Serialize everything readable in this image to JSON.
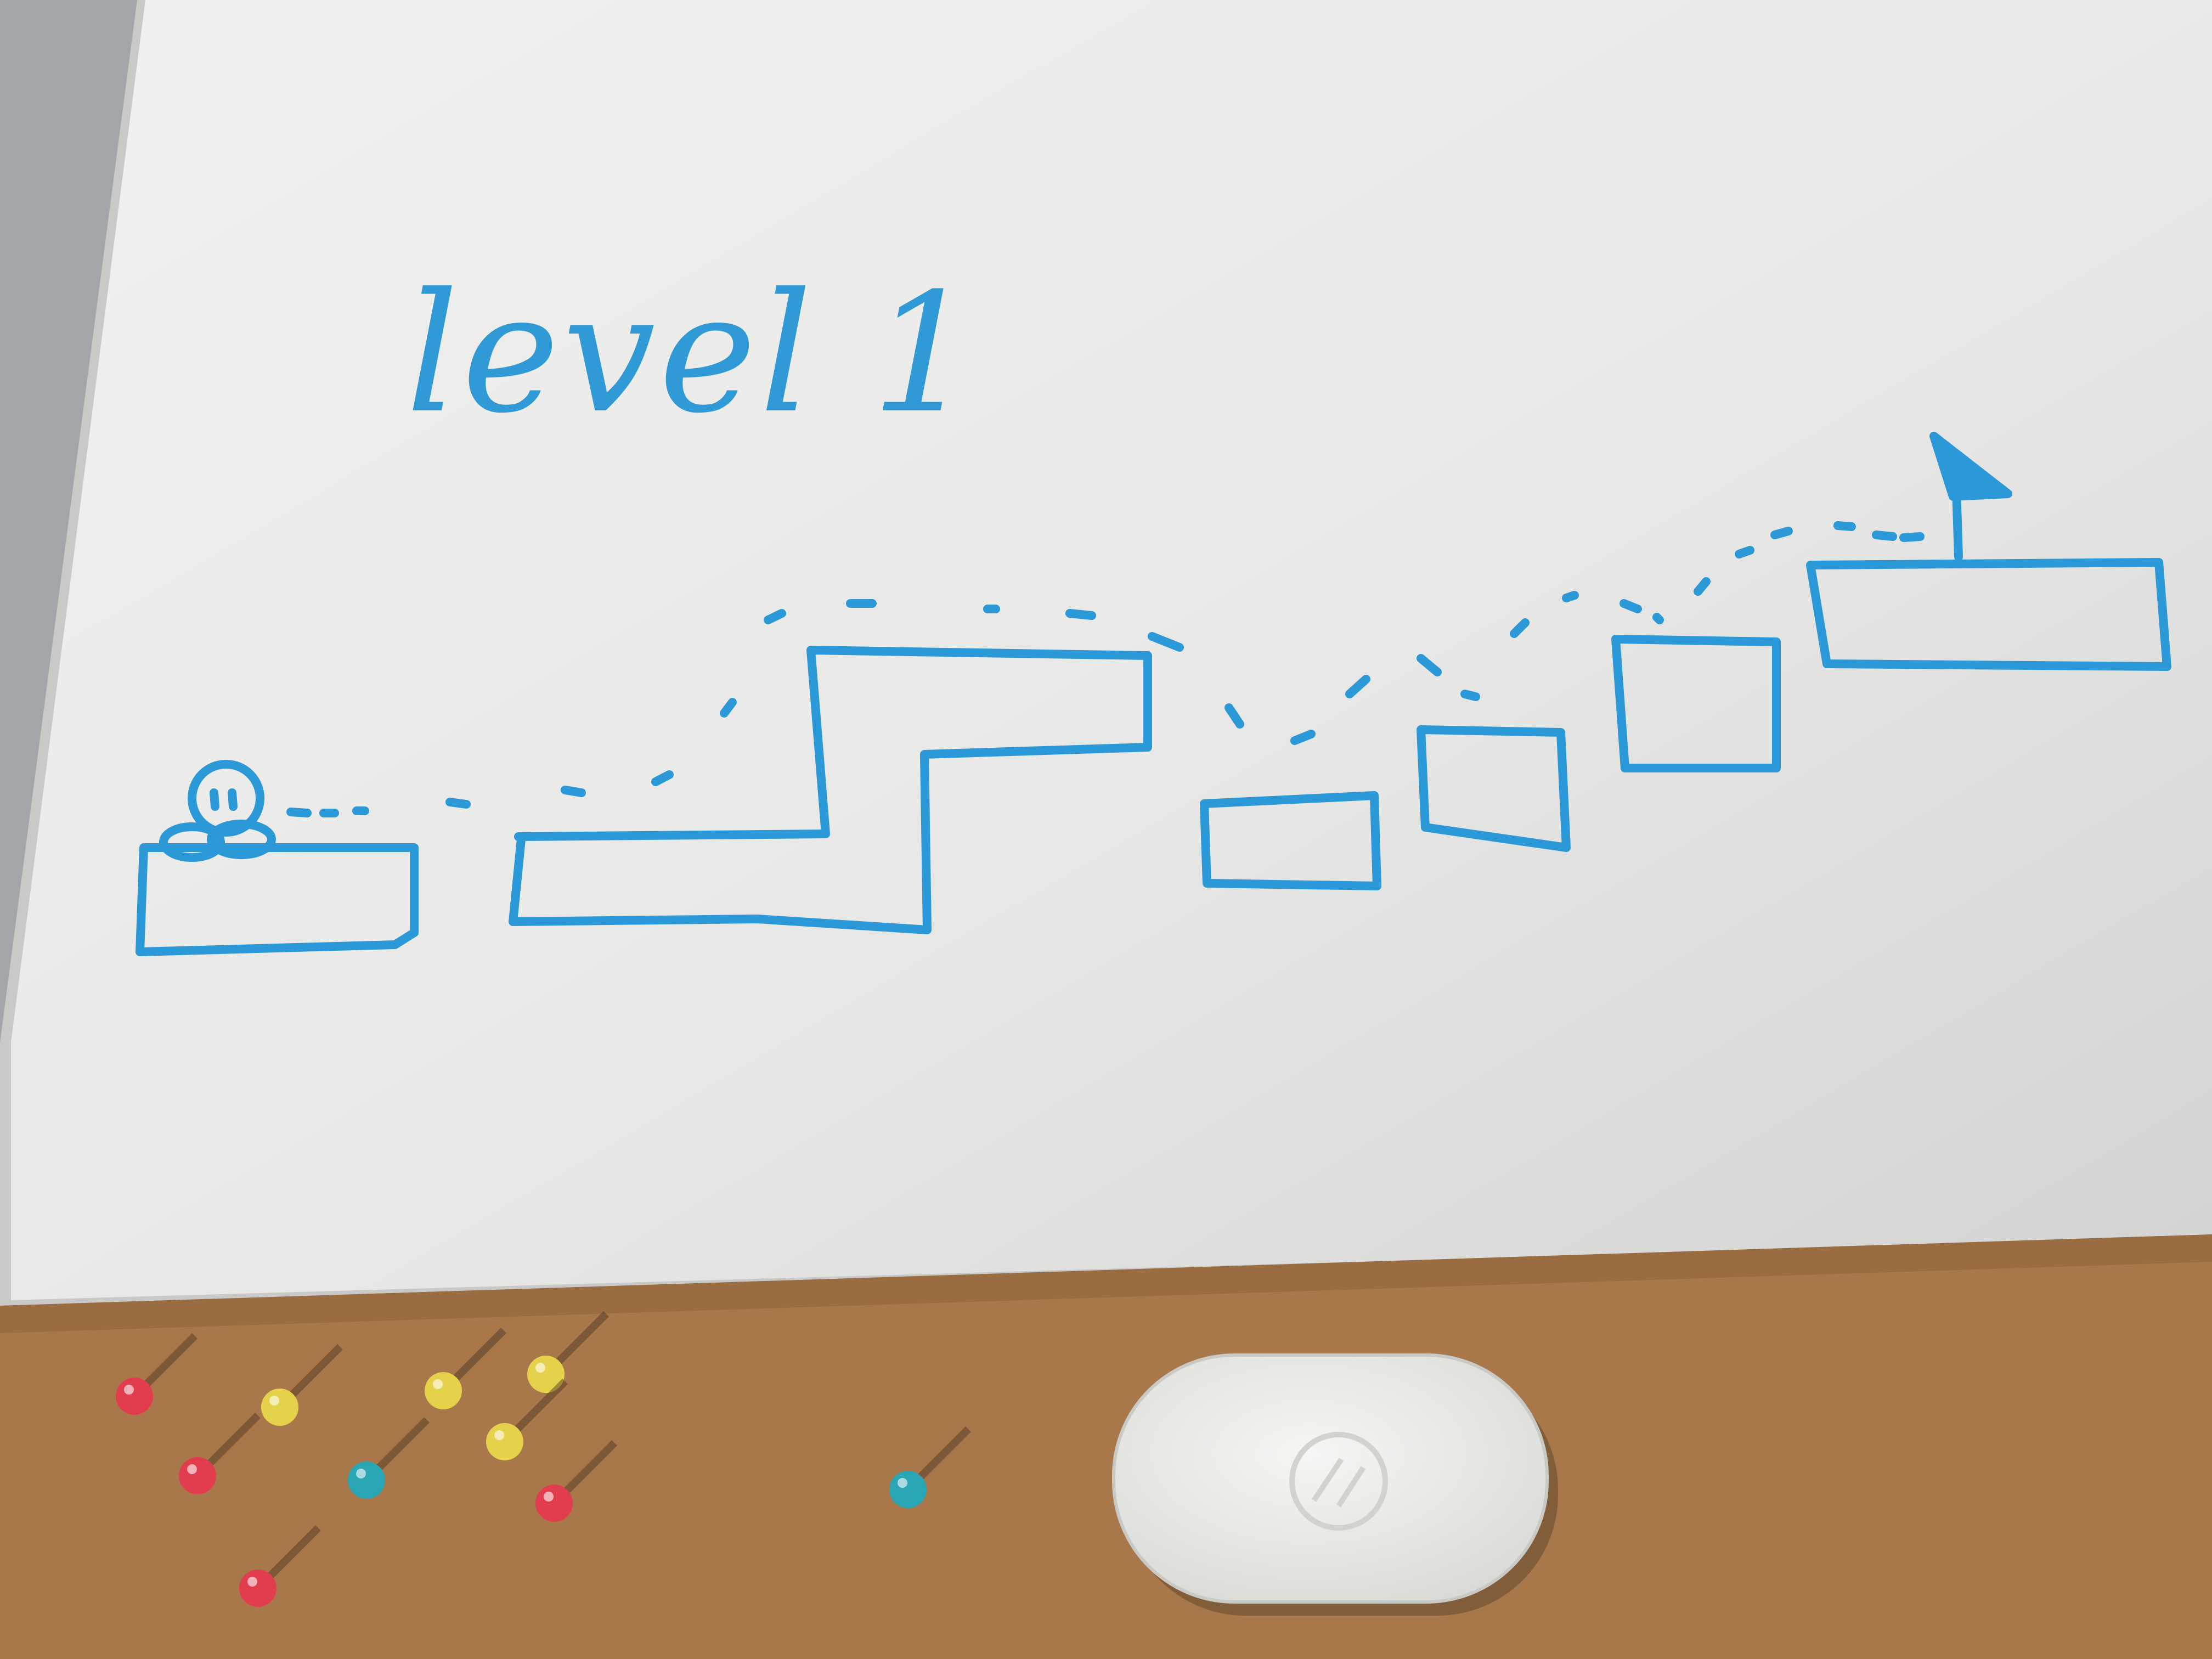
{
  "drawing": {
    "title": "level 1",
    "marker_color": "#2b98d8",
    "board_color": "#e9e9e7",
    "character": "round-blob-character",
    "goal": "triangle-flag-icon"
  },
  "corkboard": {
    "color": "#a8784b",
    "pins": [
      {
        "color": "#e23d4f"
      },
      {
        "color": "#e6d24a"
      },
      {
        "color": "#e6d24a"
      },
      {
        "color": "#e6d24a"
      },
      {
        "color": "#e23d4f"
      },
      {
        "color": "#2aa6b4"
      },
      {
        "color": "#e6d24a"
      },
      {
        "color": "#e23d4f"
      },
      {
        "color": "#e23d4f"
      },
      {
        "color": "#2aa6b4"
      }
    ],
    "device": "white-wireless-mouse"
  }
}
